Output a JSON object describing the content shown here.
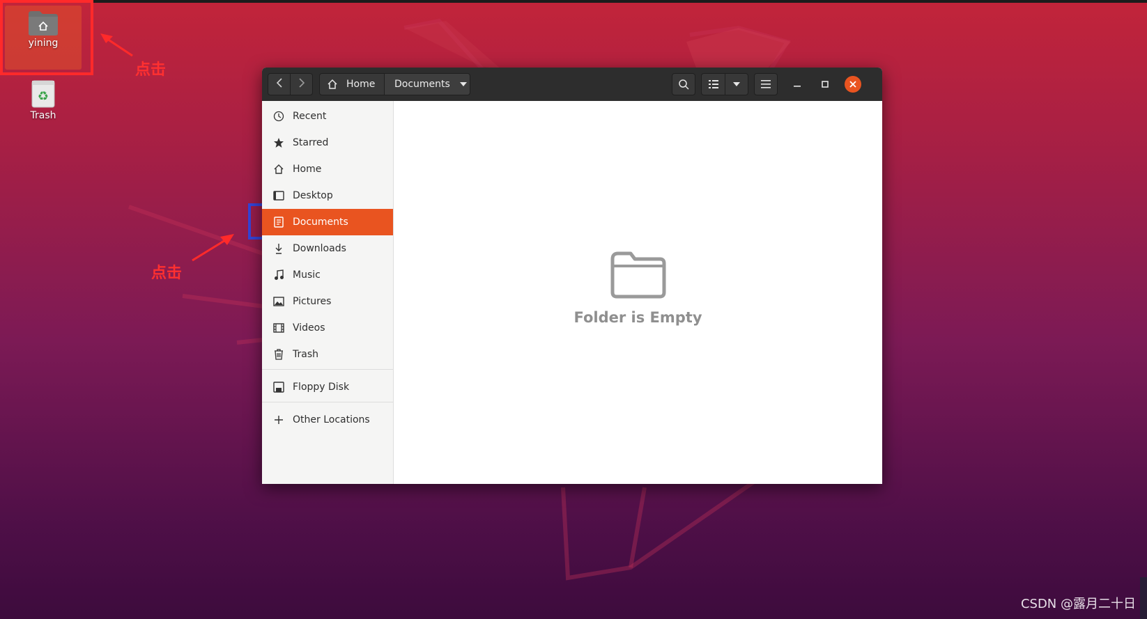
{
  "desktop": {
    "home_label": "yining",
    "trash_label": "Trash"
  },
  "annotations": {
    "click_1": "点击",
    "click_2": "点击"
  },
  "window": {
    "path": {
      "home": "Home",
      "current": "Documents"
    },
    "sidebar": {
      "items": [
        {
          "label": "Recent",
          "icon": "clock-icon"
        },
        {
          "label": "Starred",
          "icon": "star-icon"
        },
        {
          "label": "Home",
          "icon": "home-icon"
        },
        {
          "label": "Desktop",
          "icon": "desktop-icon"
        },
        {
          "label": "Documents",
          "icon": "document-icon",
          "active": true
        },
        {
          "label": "Downloads",
          "icon": "download-icon"
        },
        {
          "label": "Music",
          "icon": "music-icon"
        },
        {
          "label": "Pictures",
          "icon": "picture-icon"
        },
        {
          "label": "Videos",
          "icon": "video-icon"
        },
        {
          "label": "Trash",
          "icon": "trash-icon"
        }
      ],
      "devices": [
        {
          "label": "Floppy Disk",
          "icon": "floppy-icon"
        }
      ],
      "other": {
        "label": "Other Locations",
        "icon": "plus-icon"
      }
    },
    "content": {
      "empty_text": "Folder is Empty"
    }
  },
  "watermark": "CSDN @露月二十日",
  "colors": {
    "accent": "#e95420",
    "annotation_red": "#ff2a2a",
    "annotation_blue": "#3545d8"
  }
}
